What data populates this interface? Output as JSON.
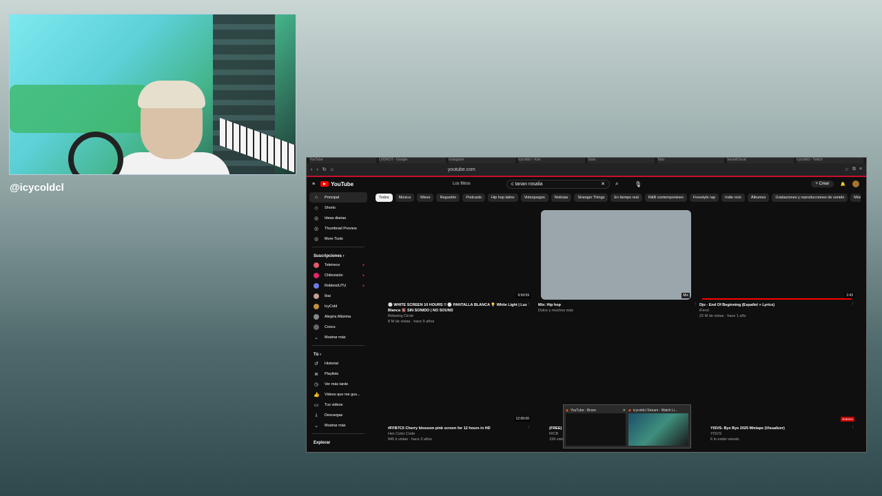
{
  "stream": {
    "handle": "@icycoldcl"
  },
  "browser": {
    "tabs": [
      "YouTube",
      "LOOKOT - Google",
      "Instagram",
      "icycoldcl - Kick",
      "Stats",
      "Tabs",
      "SoundCloud",
      "Icycoldcl - Twitch"
    ],
    "url": "youtube.com"
  },
  "youtube": {
    "logo_text": "YouTube",
    "filters_label": "Los filtros",
    "search_value": "c tanan rosalia",
    "create_label": "Crear",
    "sidebar": {
      "main": [
        {
          "label": "Principal",
          "icon": "home-icon"
        },
        {
          "label": "Shorts",
          "icon": "shorts-icon"
        },
        {
          "label": "Ideas diarias",
          "icon": "idea-icon"
        },
        {
          "label": "Thumbnail Preview",
          "icon": "preview-icon"
        },
        {
          "label": "More Tools",
          "icon": "tools-icon"
        }
      ],
      "subs_header": "Suscripciones",
      "subs": [
        {
          "label": "Teletrece",
          "color": "#e05a6a"
        },
        {
          "label": "Chilevisión",
          "color": "#e0256d"
        },
        {
          "label": "RobleisIUTU",
          "color": "#6a7ee0"
        },
        {
          "label": "Ibai",
          "color": "#c0a090"
        },
        {
          "label": "IcyCold",
          "color": "#c09040"
        },
        {
          "label": "Alegría Máxima",
          "color": "#888888"
        },
        {
          "label": "Coscu",
          "color": "#666666"
        },
        {
          "label": "Mostrar más",
          "color": ""
        }
      ],
      "you_header": "Tú",
      "you": [
        {
          "label": "Historial",
          "icon": "history-icon"
        },
        {
          "label": "Playlists",
          "icon": "playlist-icon"
        },
        {
          "label": "Ver más tarde",
          "icon": "clock-icon"
        },
        {
          "label": "Videos que me gus...",
          "icon": "like-icon"
        },
        {
          "label": "Tus videos",
          "icon": "video-icon"
        },
        {
          "label": "Descargas",
          "icon": "download-icon"
        },
        {
          "label": "Mostrar más",
          "icon": "chevron-down-icon"
        }
      ],
      "explore_header": "Explorar"
    },
    "chips": [
      "Todos",
      "Música",
      "Mixes",
      "Reguetón",
      "Podcasts",
      "Hip hop latino",
      "Videojuegos",
      "Noticias",
      "Stranger Things",
      "En tiempo real",
      "R&B contemporáneo",
      "Freestyle rap",
      "Indie rock",
      "Álbumes",
      "Grabaciones y reproducciones de sonido",
      "Músi"
    ],
    "videos": [
      {
        "title": "⚪ WHITE SCREEN 10 HOURS !! ⚪ PANTALLA BLANCA 💡 White Light | Luz Blanca 🔇 SIN SONIDO | NO SOUND",
        "channel": "Relaxing Circle",
        "stats": "8 M de vistas · hace 5 años",
        "duration": "9:59:59"
      },
      {
        "title": "Mix: Hip hop",
        "channel": "Dolce y muchos más",
        "stats": "",
        "duration": "Mix"
      },
      {
        "title": "Djo - End Of Beginning (Español + Lyrics)",
        "channel": "iFerol",
        "stats": "22 M de vistas · hace 1 año",
        "duration": "2:43"
      },
      {
        "title": "#FFB7C5 Cherry blossom pink screen for 12 hours in HD",
        "channel": "Hex Color Code",
        "stats": "845 k vistas · hace 3 años",
        "duration": "12:00:00"
      },
      {
        "title": "(FREE) 2025",
        "channel": "RICB",
        "stats": "199 vistas",
        "duration": ""
      },
      {
        "title": "YISVS- Bye Bye 2025 Mixtape (Visualizer)",
        "channel": "YISVS",
        "stats": "6 lo están viendo",
        "duration": "Estreno"
      }
    ],
    "popup": [
      {
        "title": "YouTube - Brave"
      },
      {
        "title": "icycoldcl Stream - Watch Li..."
      }
    ]
  }
}
